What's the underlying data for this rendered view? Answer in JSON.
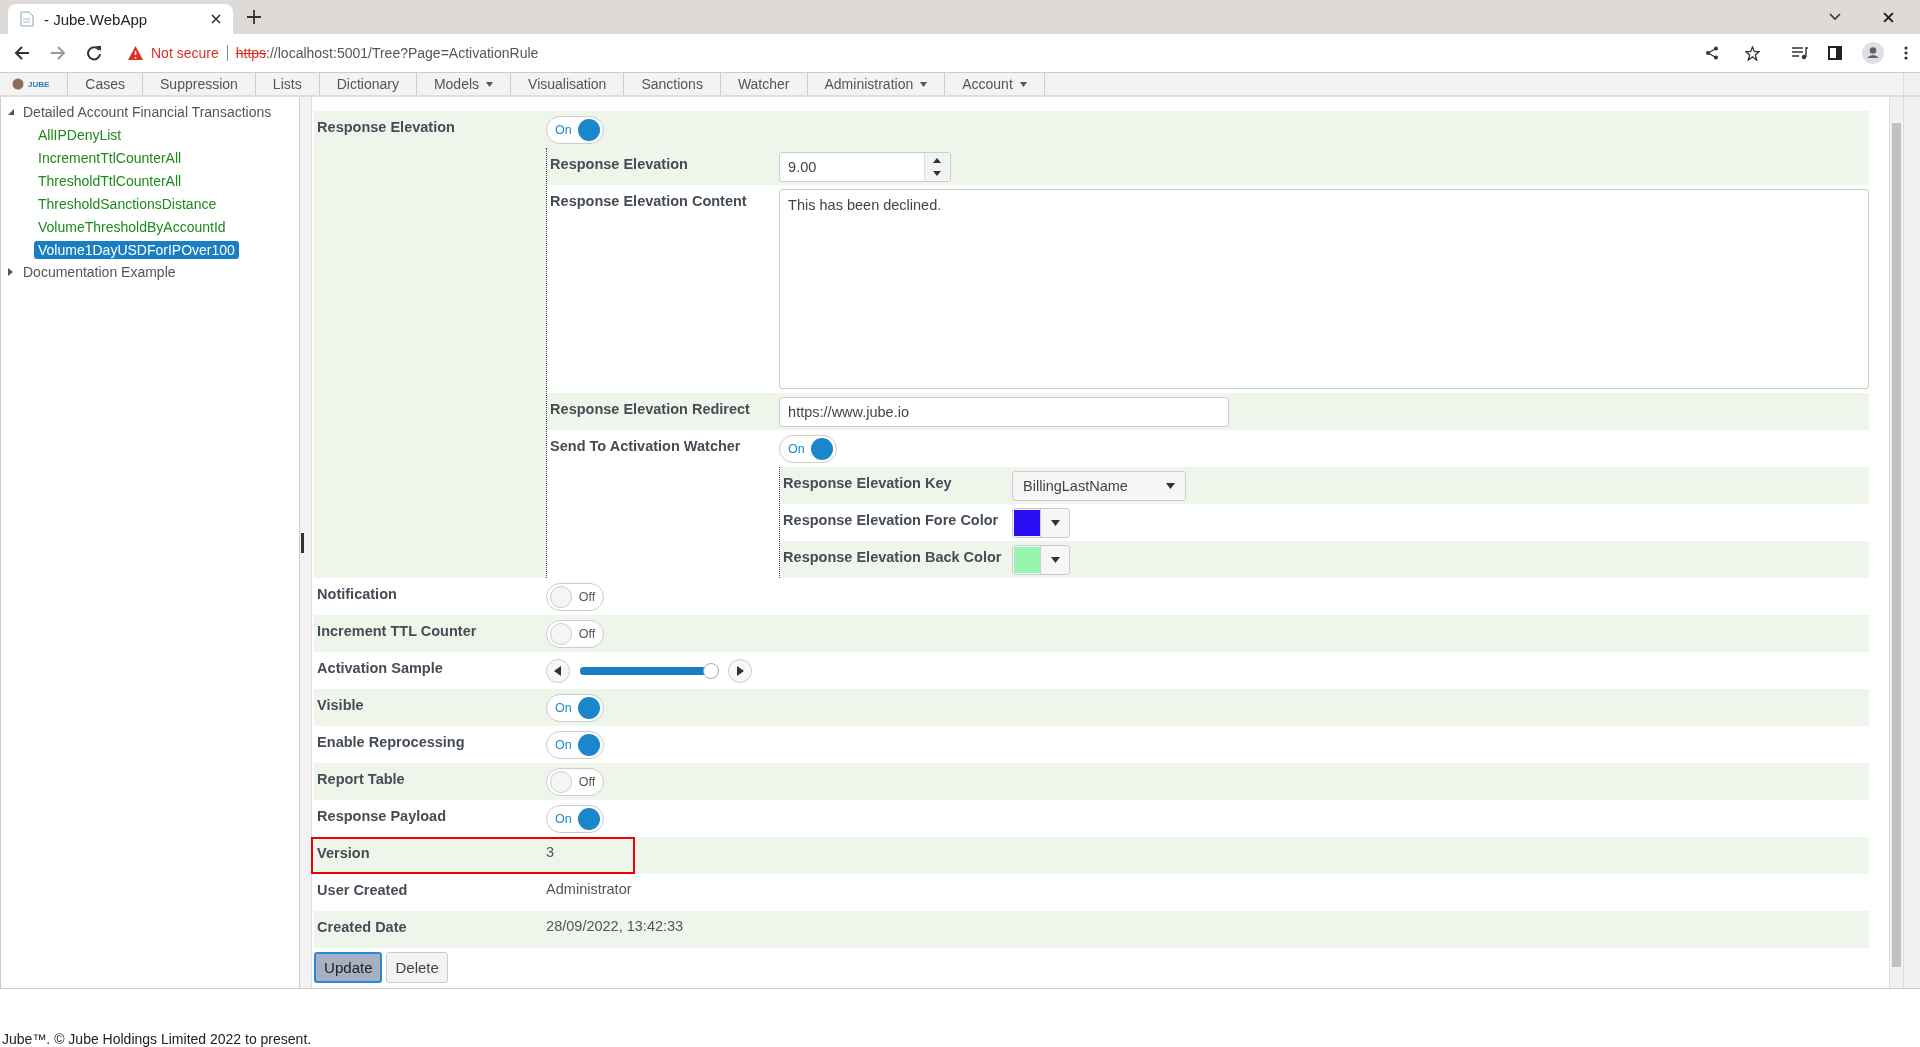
{
  "browser": {
    "tab_title": "- Jube.WebApp",
    "security": "Not secure",
    "url_scheme": "https",
    "url_rest": "://localhost:5001/Tree?Page=ActivationRule"
  },
  "nav": {
    "logo_text": "JUBE",
    "items": [
      {
        "label": "Cases",
        "dropdown": false
      },
      {
        "label": "Suppression",
        "dropdown": false
      },
      {
        "label": "Lists",
        "dropdown": false
      },
      {
        "label": "Dictionary",
        "dropdown": false
      },
      {
        "label": "Models",
        "dropdown": true
      },
      {
        "label": "Visualisation",
        "dropdown": false
      },
      {
        "label": "Sanctions",
        "dropdown": false
      },
      {
        "label": "Watcher",
        "dropdown": false
      },
      {
        "label": "Administration",
        "dropdown": true
      },
      {
        "label": "Account",
        "dropdown": true
      }
    ]
  },
  "tree": [
    {
      "label": "Detailed Account Financial Transactions",
      "expanded": true,
      "children": [
        {
          "label": "AllIPDenyList",
          "selected": false
        },
        {
          "label": "IncrementTtlCounterAll",
          "selected": false
        },
        {
          "label": "ThresholdTtlCounterAll",
          "selected": false
        },
        {
          "label": "ThresholdSanctionsDistance",
          "selected": false
        },
        {
          "label": "VolumeThresholdByAccountId",
          "selected": false
        },
        {
          "label": "Volume1DayUSDForIPOver100",
          "selected": true
        }
      ]
    },
    {
      "label": "Documentation Example",
      "expanded": false
    }
  ],
  "form": {
    "rows": [
      {
        "label": "Response Elevation",
        "kind": "toggle",
        "on": true,
        "state_label": "On",
        "children": [
          {
            "label": "Response Elevation",
            "kind": "number",
            "value": "9.00"
          },
          {
            "label": "Response Elevation Content",
            "kind": "textarea",
            "value": "This has been declined."
          },
          {
            "label": "Response Elevation Redirect",
            "kind": "text",
            "value": "https://www.jube.io"
          },
          {
            "label": "Send To Activation Watcher",
            "kind": "toggle",
            "on": true,
            "state_label": "On",
            "children": [
              {
                "label": "Response Elevation Key",
                "kind": "select",
                "value": "BillingLastName"
              },
              {
                "label": "Response Elevation Fore Color",
                "kind": "color",
                "color": "#2a0ef5"
              },
              {
                "label": "Response Elevation Back Color",
                "kind": "color",
                "color": "#98f5b0"
              }
            ]
          }
        ]
      },
      {
        "label": "Notification",
        "kind": "toggle",
        "on": false,
        "state_label": "Off"
      },
      {
        "label": "Increment TTL Counter",
        "kind": "toggle",
        "on": false,
        "state_label": "Off"
      },
      {
        "label": "Activation Sample",
        "kind": "slider",
        "level": 0.95
      },
      {
        "label": "Visible",
        "kind": "toggle",
        "on": true,
        "state_label": "On"
      },
      {
        "label": "Enable Reprocessing",
        "kind": "toggle",
        "on": true,
        "state_label": "On"
      },
      {
        "label": "Report Table",
        "kind": "toggle",
        "on": false,
        "state_label": "Off"
      },
      {
        "label": "Response Payload",
        "kind": "toggle",
        "on": true,
        "state_label": "On"
      },
      {
        "label": "Version",
        "kind": "value",
        "value": "3",
        "highlighted": true
      },
      {
        "label": "User Created",
        "kind": "value",
        "value": "Administrator",
        "highlighted": false
      },
      {
        "label": "Created Date",
        "kind": "value",
        "value": "28/09/2022, 13:42:33",
        "highlighted": false
      }
    ],
    "buttons": [
      {
        "label": "Update",
        "focused": true
      },
      {
        "label": "Delete",
        "focused": false
      }
    ]
  },
  "footer": "Jube™. © Jube Holdings Limited 2022 to present."
}
